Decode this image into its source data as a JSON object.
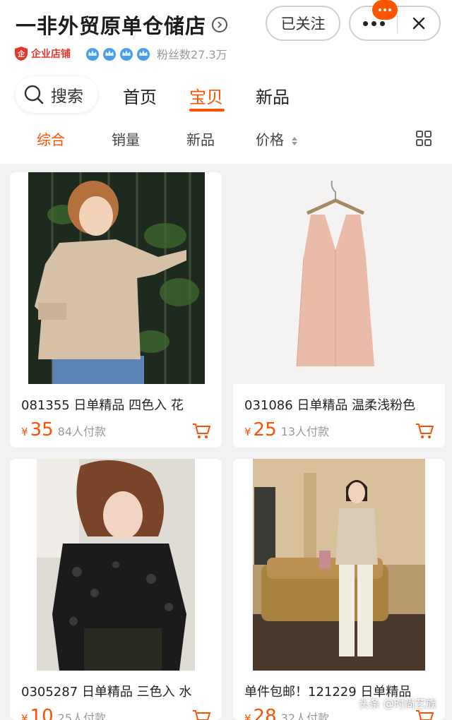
{
  "header": {
    "shop_name": "一非外贸原单仓储店",
    "follow_label": "已关注",
    "enterprise_label": "企业店铺",
    "crown_count": 4,
    "fans_text": "粉丝数27.3万"
  },
  "nav": {
    "search_label": "搜索",
    "tabs": [
      {
        "label": "首页",
        "active": false
      },
      {
        "label": "宝贝",
        "active": true
      },
      {
        "label": "新品",
        "active": false
      }
    ]
  },
  "sort_bar": {
    "items": [
      {
        "label": "综合",
        "active": true
      },
      {
        "label": "销量",
        "active": false
      },
      {
        "label": "新品",
        "active": false
      },
      {
        "label": "价格",
        "active": false
      }
    ]
  },
  "colors": {
    "accent": "#ff5000",
    "enterprise_red": "#e8352c",
    "crown_blue": "#4a9ee8"
  },
  "products": [
    {
      "title": "081355 日单精品 四色入 花",
      "currency": "¥",
      "price": "35",
      "sold": "84人付款"
    },
    {
      "title": "031086 日单精品 温柔浅粉色",
      "currency": "¥",
      "price": "25",
      "sold": "13人付款"
    },
    {
      "title": "0305287 日单精品 三色入 水",
      "currency": "¥",
      "price": "10",
      "sold": "25人付款"
    },
    {
      "title": "单件包邮！121229 日单精品",
      "currency": "¥",
      "price": "28",
      "sold": "32人付款"
    }
  ],
  "watermark": "头条 @时尚艺族"
}
